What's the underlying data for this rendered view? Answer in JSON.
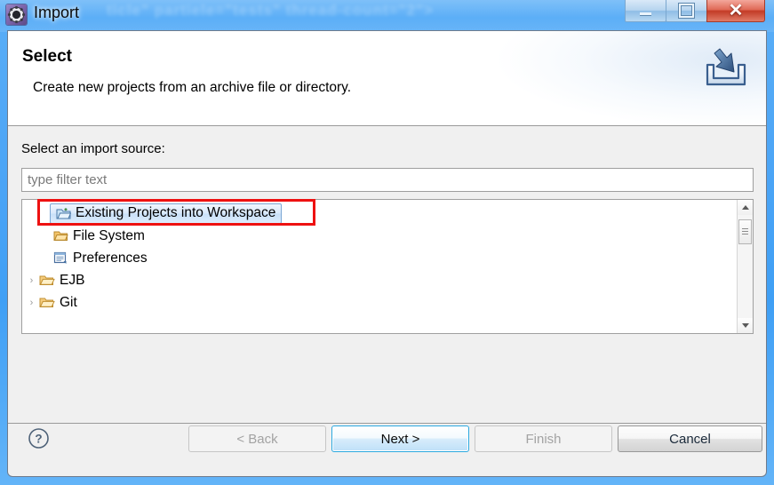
{
  "window": {
    "title": "Import",
    "title_icon": "gear-icon",
    "ghost_text": "ticle\" partiele=\"tests\" thread-count=\"2\">",
    "controls": {
      "minimize": "minimize-button",
      "maximize": "maximize-button",
      "close_glyph": "✕"
    }
  },
  "header": {
    "title": "Select",
    "subtitle": "Create new projects from an archive file or directory.",
    "icon": "import-wizard-icon"
  },
  "form": {
    "source_label": "Select an import source:",
    "filter_placeholder": "type filter text",
    "filter_value": ""
  },
  "tree": {
    "items": [
      {
        "label": "Existing Projects into Workspace",
        "icon": "import-project-folder-icon",
        "depth": 1,
        "expandable": false,
        "selected": true
      },
      {
        "label": "File System",
        "icon": "folder-icon",
        "depth": 1,
        "expandable": false,
        "selected": false
      },
      {
        "label": "Preferences",
        "icon": "preferences-document-icon",
        "depth": 1,
        "expandable": false,
        "selected": false
      },
      {
        "label": "EJB",
        "icon": "open-folder-icon",
        "depth": 0,
        "expandable": true,
        "selected": false
      },
      {
        "label": "Git",
        "icon": "open-folder-icon",
        "depth": 0,
        "expandable": true,
        "selected": false
      }
    ],
    "expander_glyph": "›"
  },
  "scrollbar": {
    "up_arrow": "scroll-up-arrow",
    "down_arrow": "scroll-down-arrow"
  },
  "annotation": {
    "highlight_color": "#ee1111",
    "target": "Existing Projects into Workspace"
  },
  "footer": {
    "help": "?",
    "back_label": "< Back",
    "next_label": "Next >",
    "finish_label": "Finish",
    "cancel_label": "Cancel",
    "back_enabled": false,
    "next_enabled": true,
    "finish_enabled": false,
    "cancel_enabled": true
  },
  "colors": {
    "accent": "#2aa8e0",
    "titlebar": "#4aa3f5",
    "dialog_bg": "#f0f0f0",
    "selection": "#c9e0f8"
  }
}
